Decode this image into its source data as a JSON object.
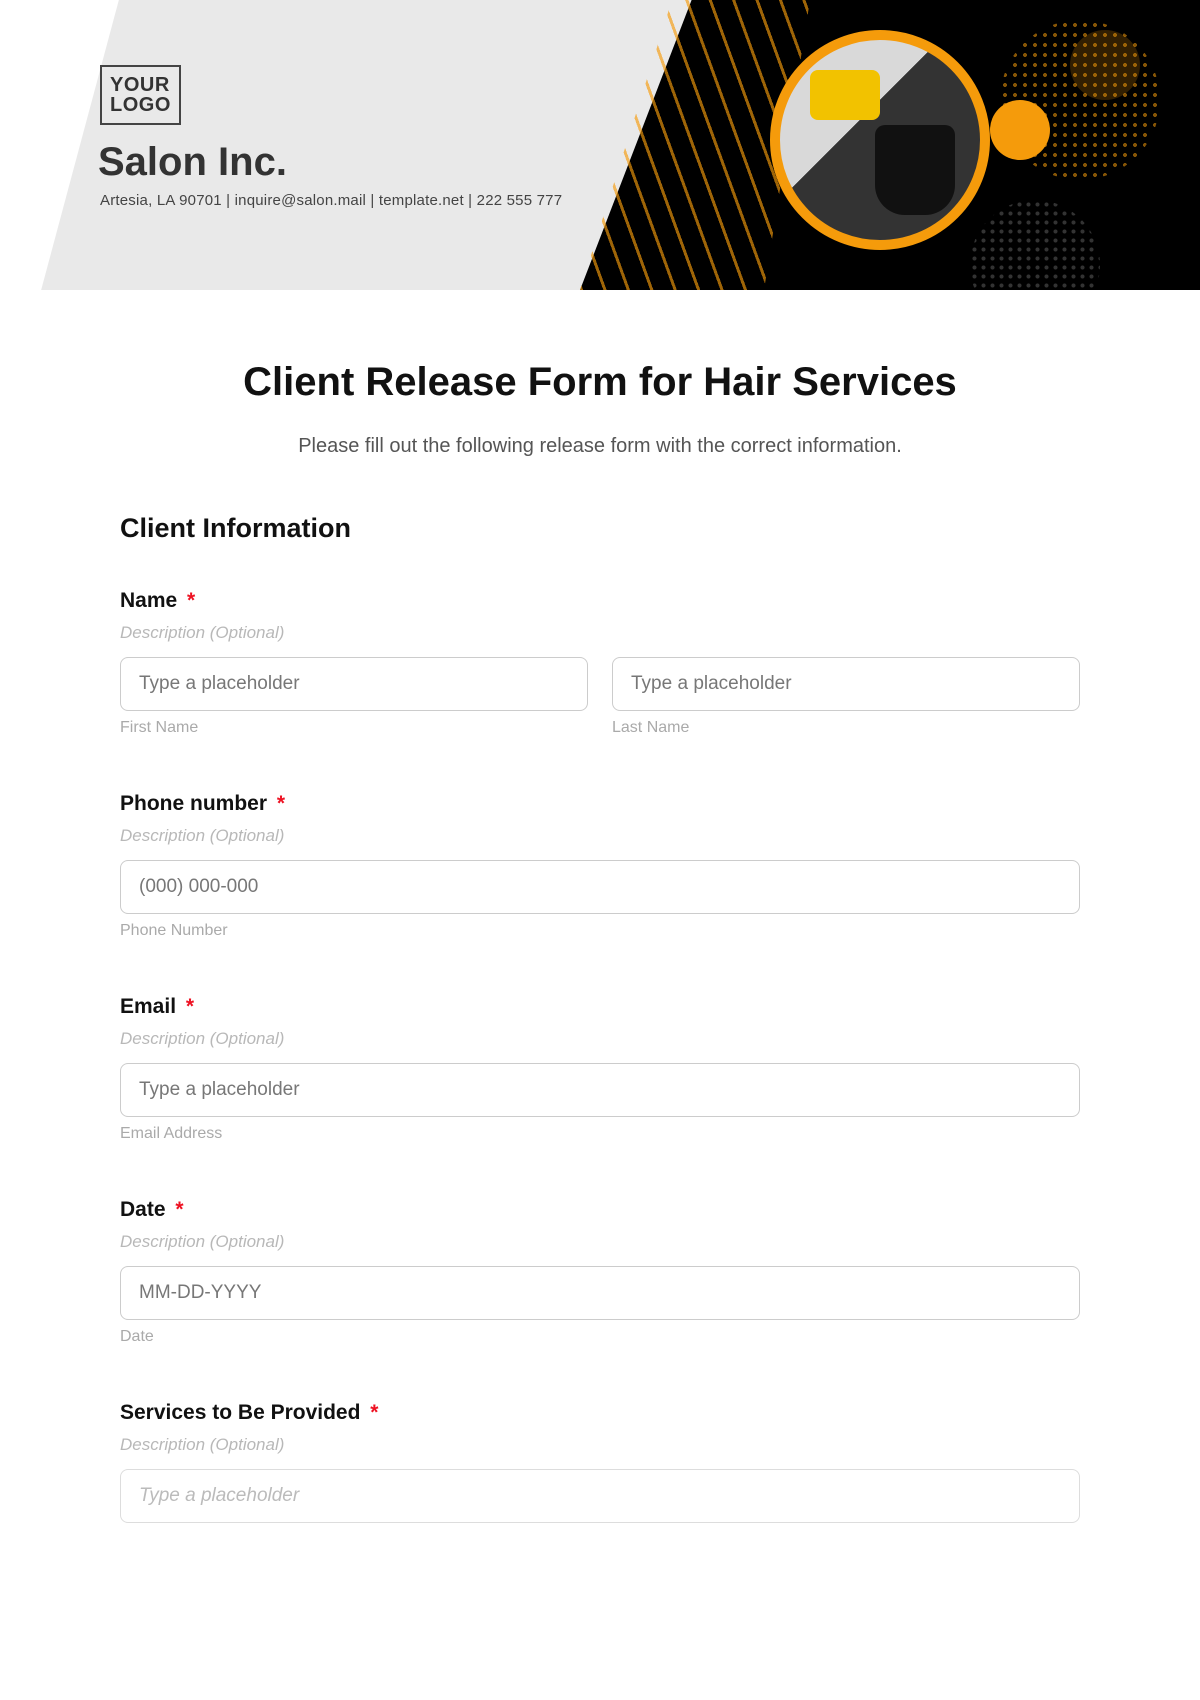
{
  "header": {
    "logo_line1": "YOUR",
    "logo_line2": "LOGO",
    "company_name": "Salon Inc.",
    "company_info": "Artesia, LA 90701 | inquire@salon.mail | template.net | 222 555 777"
  },
  "form": {
    "title": "Client Release Form for Hair Services",
    "subtitle": "Please fill out the following release form with the correct information.",
    "section_heading": "Client Information",
    "fields": {
      "name": {
        "label": "Name",
        "required_mark": "*",
        "description": "Description (Optional)",
        "first_placeholder": "Type a placeholder",
        "first_sub": "First Name",
        "last_placeholder": "Type a placeholder",
        "last_sub": "Last Name"
      },
      "phone": {
        "label": "Phone number",
        "required_mark": "*",
        "description": "Description (Optional)",
        "placeholder": "(000) 000-000",
        "sub": "Phone Number"
      },
      "email": {
        "label": "Email",
        "required_mark": "*",
        "description": "Description (Optional)",
        "placeholder": "Type a placeholder",
        "sub": "Email Address"
      },
      "date": {
        "label": "Date",
        "required_mark": "*",
        "description": "Description (Optional)",
        "placeholder": "MM-DD-YYYY",
        "sub": "Date"
      },
      "services": {
        "label": "Services to Be Provided",
        "required_mark": "*",
        "description": "Description (Optional)",
        "placeholder": "Type a placeholder"
      }
    }
  }
}
